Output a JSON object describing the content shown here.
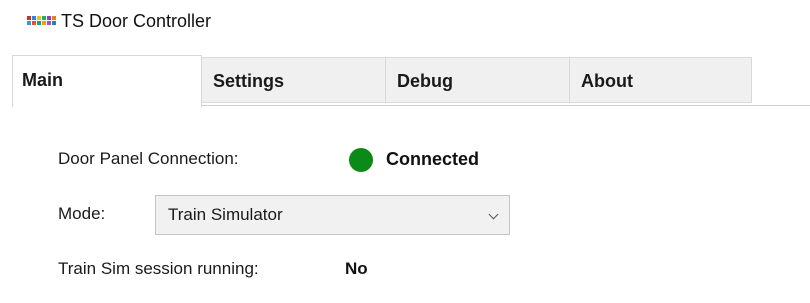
{
  "window": {
    "title": "TS Door Controller",
    "icon": "app-grid-icon",
    "icon_colors": [
      "#c0392b",
      "#2e86de",
      "#f1c40f",
      "#27ae60",
      "#8e44ad",
      "#e67e22",
      "#3498db",
      "#e74c3c",
      "#16a085",
      "#f39c12",
      "#9b59b6",
      "#2980b9"
    ]
  },
  "tabs": [
    {
      "label": "Main",
      "selected": true
    },
    {
      "label": "Settings",
      "selected": false
    },
    {
      "label": "Debug",
      "selected": false
    },
    {
      "label": "About",
      "selected": false
    }
  ],
  "main": {
    "connection_label": "Door Panel Connection:",
    "connection_status": "Connected",
    "connection_color": "#0b8a17",
    "mode_label": "Mode:",
    "mode_value": "Train Simulator",
    "session_label": "Train Sim session running:",
    "session_value": "No"
  }
}
